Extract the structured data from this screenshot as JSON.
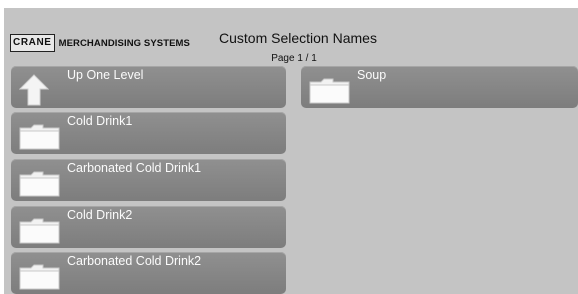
{
  "header": {
    "logo_name": "CRANE",
    "logo_sub": "MERCHANDISING SYSTEMS",
    "title": "Custom Selection Names",
    "page": "Page 1 / 1"
  },
  "left_column": {
    "up_label": "Up One Level",
    "items": [
      {
        "label": "Cold Drink1"
      },
      {
        "label": "Carbonated Cold Drink1"
      },
      {
        "label": "Cold Drink2"
      },
      {
        "label": "Carbonated Cold Drink2"
      }
    ]
  },
  "right_column": {
    "items": [
      {
        "label": "Soup"
      }
    ]
  },
  "icons": {
    "folder": "folder-icon",
    "up": "up-arrow-icon"
  }
}
